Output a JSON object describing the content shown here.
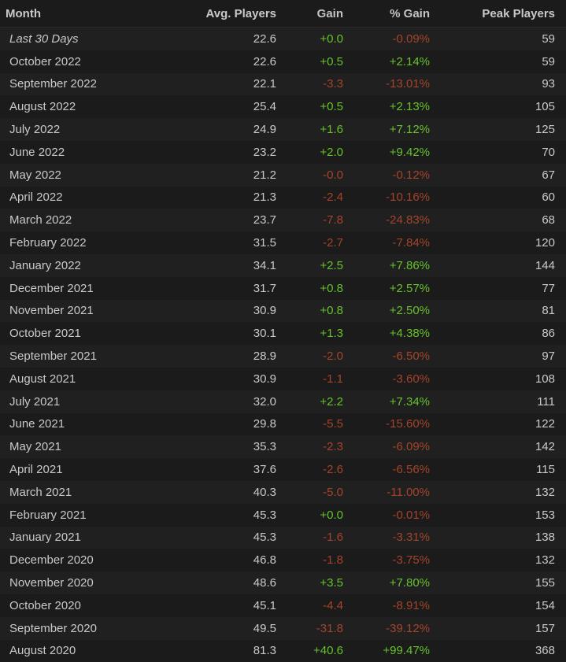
{
  "colors": {
    "background": "#1b1b1b",
    "row_alt": "#202020",
    "text": "#c9c9c9",
    "positive": "#66c22c",
    "negative": "#a5442a"
  },
  "table": {
    "headers": {
      "month": "Month",
      "avg": "Avg. Players",
      "gain": "Gain",
      "pct": "% Gain",
      "peak": "Peak Players"
    },
    "rows": [
      {
        "month": "Last 30 Days",
        "avg": "22.6",
        "gain": "+0.0",
        "pct": "-0.09%",
        "peak": "59",
        "gain_dir": "pos",
        "pct_dir": "neg",
        "italic": true
      },
      {
        "month": "October 2022",
        "avg": "22.6",
        "gain": "+0.5",
        "pct": "+2.14%",
        "peak": "59",
        "gain_dir": "pos",
        "pct_dir": "pos"
      },
      {
        "month": "September 2022",
        "avg": "22.1",
        "gain": "-3.3",
        "pct": "-13.01%",
        "peak": "93",
        "gain_dir": "neg",
        "pct_dir": "neg"
      },
      {
        "month": "August 2022",
        "avg": "25.4",
        "gain": "+0.5",
        "pct": "+2.13%",
        "peak": "105",
        "gain_dir": "pos",
        "pct_dir": "pos"
      },
      {
        "month": "July 2022",
        "avg": "24.9",
        "gain": "+1.6",
        "pct": "+7.12%",
        "peak": "125",
        "gain_dir": "pos",
        "pct_dir": "pos"
      },
      {
        "month": "June 2022",
        "avg": "23.2",
        "gain": "+2.0",
        "pct": "+9.42%",
        "peak": "70",
        "gain_dir": "pos",
        "pct_dir": "pos"
      },
      {
        "month": "May 2022",
        "avg": "21.2",
        "gain": "-0.0",
        "pct": "-0.12%",
        "peak": "67",
        "gain_dir": "neg",
        "pct_dir": "neg"
      },
      {
        "month": "April 2022",
        "avg": "21.3",
        "gain": "-2.4",
        "pct": "-10.16%",
        "peak": "60",
        "gain_dir": "neg",
        "pct_dir": "neg"
      },
      {
        "month": "March 2022",
        "avg": "23.7",
        "gain": "-7.8",
        "pct": "-24.83%",
        "peak": "68",
        "gain_dir": "neg",
        "pct_dir": "neg"
      },
      {
        "month": "February 2022",
        "avg": "31.5",
        "gain": "-2.7",
        "pct": "-7.84%",
        "peak": "120",
        "gain_dir": "neg",
        "pct_dir": "neg"
      },
      {
        "month": "January 2022",
        "avg": "34.1",
        "gain": "+2.5",
        "pct": "+7.86%",
        "peak": "144",
        "gain_dir": "pos",
        "pct_dir": "pos"
      },
      {
        "month": "December 2021",
        "avg": "31.7",
        "gain": "+0.8",
        "pct": "+2.57%",
        "peak": "77",
        "gain_dir": "pos",
        "pct_dir": "pos"
      },
      {
        "month": "November 2021",
        "avg": "30.9",
        "gain": "+0.8",
        "pct": "+2.50%",
        "peak": "81",
        "gain_dir": "pos",
        "pct_dir": "pos"
      },
      {
        "month": "October 2021",
        "avg": "30.1",
        "gain": "+1.3",
        "pct": "+4.38%",
        "peak": "86",
        "gain_dir": "pos",
        "pct_dir": "pos"
      },
      {
        "month": "September 2021",
        "avg": "28.9",
        "gain": "-2.0",
        "pct": "-6.50%",
        "peak": "97",
        "gain_dir": "neg",
        "pct_dir": "neg"
      },
      {
        "month": "August 2021",
        "avg": "30.9",
        "gain": "-1.1",
        "pct": "-3.60%",
        "peak": "108",
        "gain_dir": "neg",
        "pct_dir": "neg"
      },
      {
        "month": "July 2021",
        "avg": "32.0",
        "gain": "+2.2",
        "pct": "+7.34%",
        "peak": "111",
        "gain_dir": "pos",
        "pct_dir": "pos"
      },
      {
        "month": "June 2021",
        "avg": "29.8",
        "gain": "-5.5",
        "pct": "-15.60%",
        "peak": "122",
        "gain_dir": "neg",
        "pct_dir": "neg"
      },
      {
        "month": "May 2021",
        "avg": "35.3",
        "gain": "-2.3",
        "pct": "-6.09%",
        "peak": "142",
        "gain_dir": "neg",
        "pct_dir": "neg"
      },
      {
        "month": "April 2021",
        "avg": "37.6",
        "gain": "-2.6",
        "pct": "-6.56%",
        "peak": "115",
        "gain_dir": "neg",
        "pct_dir": "neg"
      },
      {
        "month": "March 2021",
        "avg": "40.3",
        "gain": "-5.0",
        "pct": "-11.00%",
        "peak": "132",
        "gain_dir": "neg",
        "pct_dir": "neg"
      },
      {
        "month": "February 2021",
        "avg": "45.3",
        "gain": "+0.0",
        "pct": "-0.01%",
        "peak": "153",
        "gain_dir": "pos",
        "pct_dir": "neg"
      },
      {
        "month": "January 2021",
        "avg": "45.3",
        "gain": "-1.6",
        "pct": "-3.31%",
        "peak": "138",
        "gain_dir": "neg",
        "pct_dir": "neg"
      },
      {
        "month": "December 2020",
        "avg": "46.8",
        "gain": "-1.8",
        "pct": "-3.75%",
        "peak": "132",
        "gain_dir": "neg",
        "pct_dir": "neg"
      },
      {
        "month": "November 2020",
        "avg": "48.6",
        "gain": "+3.5",
        "pct": "+7.80%",
        "peak": "155",
        "gain_dir": "pos",
        "pct_dir": "pos"
      },
      {
        "month": "October 2020",
        "avg": "45.1",
        "gain": "-4.4",
        "pct": "-8.91%",
        "peak": "154",
        "gain_dir": "neg",
        "pct_dir": "neg"
      },
      {
        "month": "September 2020",
        "avg": "49.5",
        "gain": "-31.8",
        "pct": "-39.12%",
        "peak": "157",
        "gain_dir": "neg",
        "pct_dir": "neg"
      },
      {
        "month": "August 2020",
        "avg": "81.3",
        "gain": "+40.6",
        "pct": "+99.47%",
        "peak": "368",
        "gain_dir": "pos",
        "pct_dir": "pos"
      }
    ]
  }
}
